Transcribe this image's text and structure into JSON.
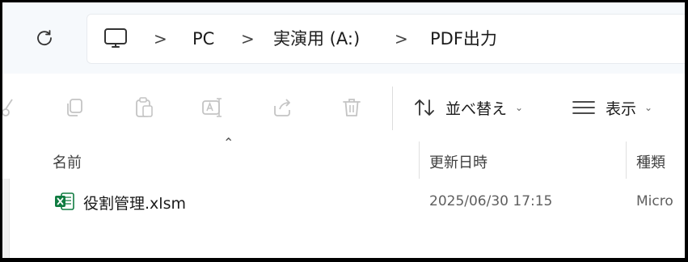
{
  "breadcrumb": {
    "items": [
      "PC",
      "実演用 (A:)",
      "PDF出力"
    ],
    "separator": ">"
  },
  "toolbar": {
    "sort_label": "並べ替え",
    "view_label": "表示"
  },
  "columns": {
    "name": "名前",
    "modified": "更新日時",
    "type": "種類"
  },
  "files": [
    {
      "name": "役割管理.xlsm",
      "modified": "2025/06/30 17:15",
      "type": "Micro",
      "icon": "excel-file-icon"
    }
  ],
  "colors": {
    "accent": "#0067c0",
    "excel_green": "#107c41",
    "disabled_icon": "#c4c4c4",
    "text": "#1b1b1b"
  }
}
